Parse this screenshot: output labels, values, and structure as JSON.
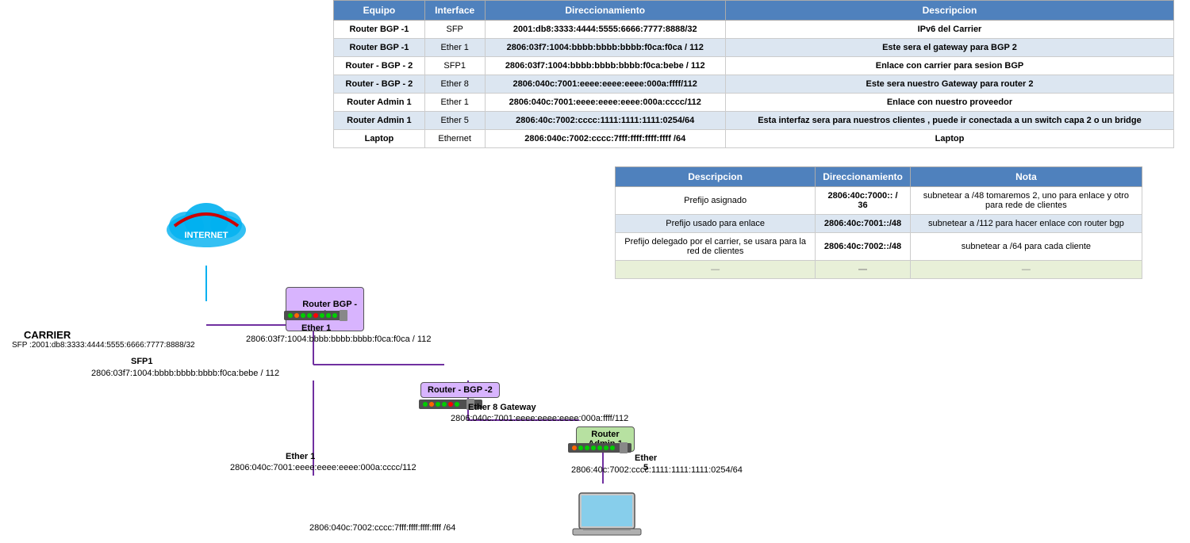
{
  "table": {
    "headers": [
      "Equipo",
      "Interface",
      "Direccionamiento",
      "Descripcion"
    ],
    "rows": [
      [
        "Router BGP -1",
        "SFP",
        "2001:db8:3333:4444:5555:6666:7777:8888/32",
        "IPv6 del Carrier"
      ],
      [
        "Router BGP -1",
        "Ether 1",
        "2806:03f7:1004:bbbb:bbbb:bbbb:f0ca:f0ca / 112",
        "Este sera el gateway para BGP 2"
      ],
      [
        "Router - BGP - 2",
        "SFP1",
        "2806:03f7:1004:bbbb:bbbb:bbbb:f0ca:bebe / 112",
        "Enlace con carrier para sesion BGP"
      ],
      [
        "Router - BGP - 2",
        "Ether 8",
        "2806:040c:7001:eeee:eeee:eeee:000a:ffff/112",
        "Este sera nuestro Gateway para router 2"
      ],
      [
        "Router Admin 1",
        "Ether 1",
        "2806:040c:7001:eeee:eeee:eeee:000a:cccc/112",
        "Enlace con nuestro proveedor"
      ],
      [
        "Router Admin 1",
        "Ether 5",
        "2806:40c:7002:cccc:1111:1111:1111:0254/64",
        "Esta interfaz sera para nuestros clientes , puede ir conectada a un switch capa 2 o un bridge"
      ],
      [
        "Laptop",
        "Ethernet",
        "2806:040c:7002:cccc:7fff:ffff:ffff:ffff /64",
        "Laptop"
      ]
    ]
  },
  "second_table": {
    "headers": [
      "Descripcion",
      "Direccionamiento",
      "Nota"
    ],
    "rows": [
      [
        "Prefijo asignado",
        "2806:40c:7000:: / 36",
        "subnetear a /48  tomaremos 2, uno para enlace y otro para rede de clientes"
      ],
      [
        "Prefijo usado para enlace",
        "2806:40c:7001::/48",
        "subnetear a /112 para hacer enlace con router bgp"
      ],
      [
        "Prefijo delegado por el carrier, se usara para la red de clientes",
        "2806:40c:7002::/48",
        "subnetear a /64 para cada cliente"
      ],
      [
        "—",
        "—",
        "—"
      ]
    ]
  },
  "diagram": {
    "internet_label": "INTERNET",
    "carrier_label": "CARRIER",
    "carrier_sfp": "SFP :2001:db8:3333:4444:5555:6666:7777:8888/32",
    "router_bgp1_label": "Router BGP -\n1",
    "ether1_label": "Ether 1",
    "ether1_addr": "2806:03f7:1004:bbbb:bbbb:bbbb:f0ca:f0ca / 112",
    "router_bgp2_label": "Router - BGP -2",
    "sfp1_label": "SFP1",
    "sfp1_addr": "2806:03f7:1004:bbbb:bbbb:bbbb:f0ca:bebe / 112",
    "ether8_label": "Ether 8 Gateway",
    "ether8_addr": "2806:040c:7001:eeee:eeee:eeee:000a:ffff/112",
    "router_admin1_label": "Router Admin 1",
    "ether1_admin_label": "Ether 1",
    "ether1_admin_addr": "2806:040c:7001:eeee:eeee:eeee:000a:cccc/112",
    "ether5_label": "Ether 5",
    "ether5_addr": "2806:40c:7002:cccc:1111:1111:1111:0254/64",
    "laptop_addr": "2806:040c:7002:cccc:7fff:ffff:ffff:ffff /64",
    "laptop_label": "Laptop"
  }
}
